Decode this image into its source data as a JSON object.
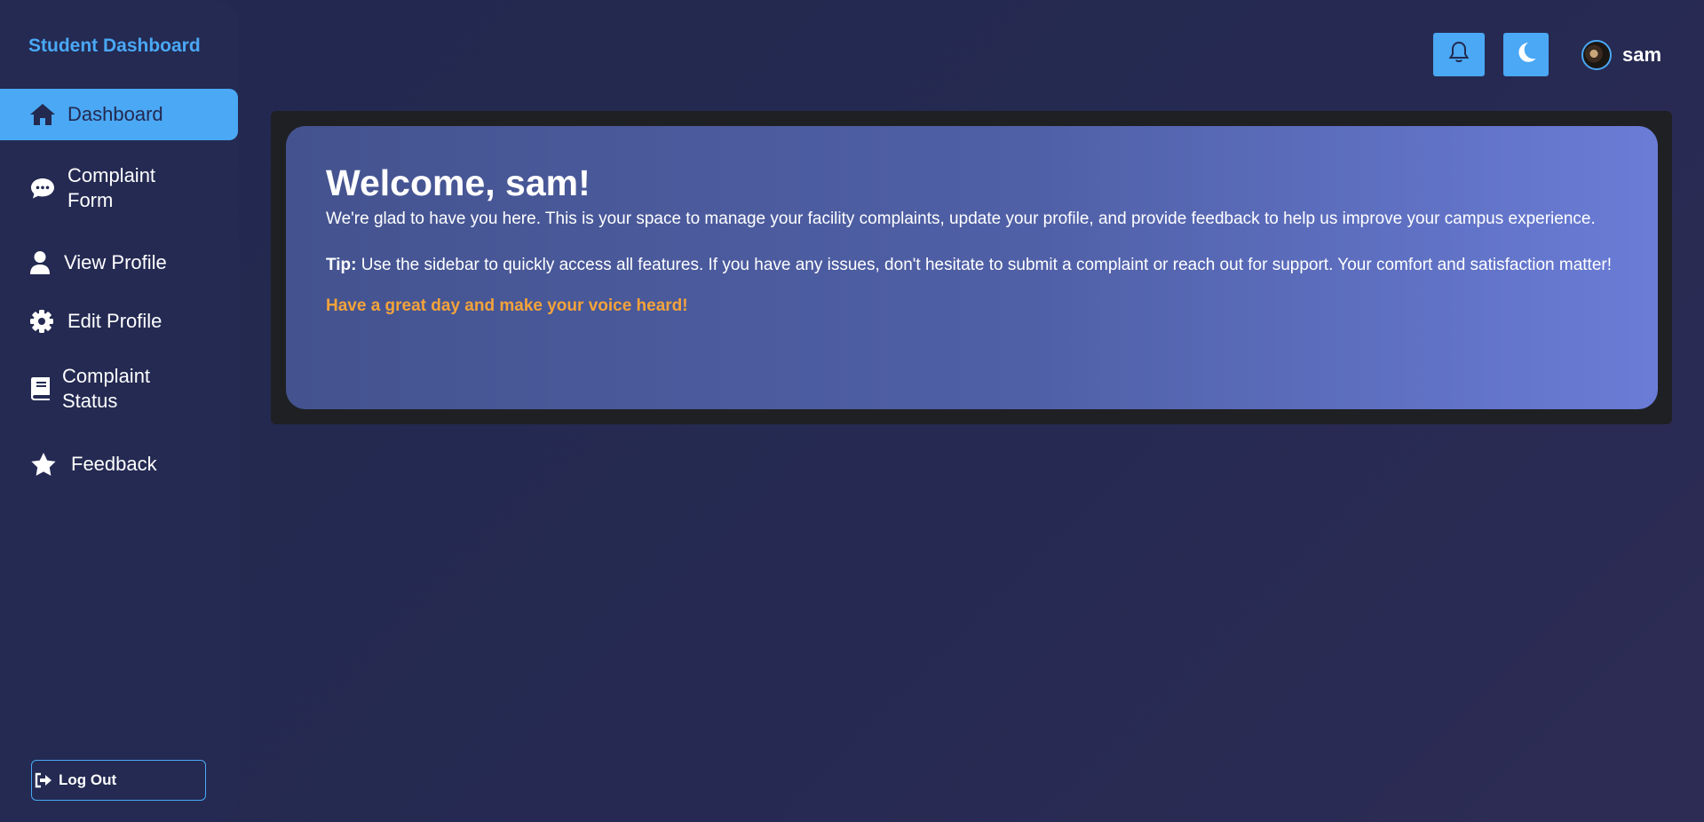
{
  "brand": "Student Dashboard",
  "nav": [
    {
      "label": "Dashboard",
      "icon": "home-icon",
      "active": true
    },
    {
      "label": "Complaint Form",
      "icon": "chat-bubble-icon",
      "active": false
    },
    {
      "label": "View Profile",
      "icon": "user-icon",
      "active": false
    },
    {
      "label": "Edit Profile",
      "icon": "gear-icon",
      "active": false
    },
    {
      "label": "Complaint Status",
      "icon": "book-icon",
      "active": false
    },
    {
      "label": "Feedback",
      "icon": "star-icon",
      "active": false
    }
  ],
  "logout_label": "Log Out",
  "topbar": {
    "notifications_icon": "bell-icon",
    "theme_icon": "moon-icon",
    "username": "sam"
  },
  "welcome": {
    "title": "Welcome, sam!",
    "intro": "We're glad to have you here. This is your space to manage your facility complaints, update your profile, and provide feedback to help us improve your campus experience.",
    "tip_label": "Tip:",
    "tip_text": " Use the sidebar to quickly access all features. If you have any issues, don't hesitate to submit a complaint or reach out for support. Your comfort and satisfaction matter!",
    "closing": "Have a great day and make your voice heard!"
  },
  "colors": {
    "accent": "#4aa8f5",
    "background": "#23294f",
    "highlight": "#f4a33a"
  }
}
